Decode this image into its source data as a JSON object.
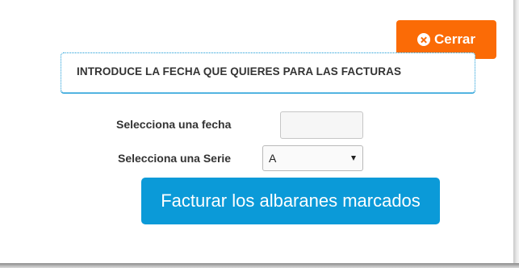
{
  "close_button": {
    "label": "Cerrar",
    "icon": "close-circle-icon",
    "color": "#fb6b06"
  },
  "header": {
    "title": "INTRODUCE LA FECHA QUE QUIERES PARA LAS FACTURAS",
    "border_color": "#1a9bd7"
  },
  "form": {
    "date_label": "Selecciona una fecha",
    "date_value": "",
    "serie_label": "Selecciona una Serie",
    "serie_value": "A"
  },
  "submit_button": {
    "label": "Facturar los albaranes marcados",
    "color": "#0b9ad8"
  }
}
